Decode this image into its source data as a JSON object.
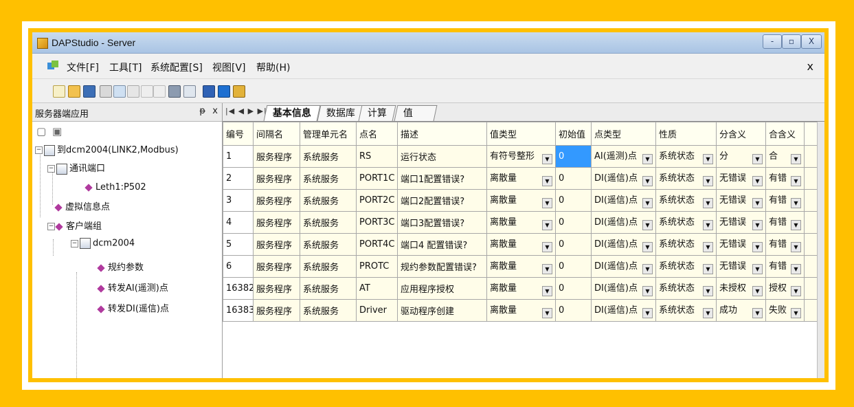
{
  "window": {
    "title": "DAPStudio - Server",
    "minimize_label": "-",
    "maximize_label": "▫",
    "close_label": "X"
  },
  "menu": {
    "items": [
      "文件[F]",
      "工具[T]",
      "系统配置[S]",
      "视图[V]",
      "帮助(H)"
    ],
    "close_label": "x"
  },
  "left_panel": {
    "title": "服务器端应用",
    "pin_label": "ᵽ",
    "close_label": "x",
    "tree": {
      "root": "到dcm2004(LINK2,Modbus)",
      "comm_port": "通讯端口",
      "eth": "Leth1:P502",
      "virtual": "虚拟信息点",
      "client_group": "客户端组",
      "dcm": "dcm2004",
      "protocol_params": "规约参数",
      "fwd_ai": "转发AI(遥测)点",
      "fwd_di": "转发DI(遥信)点"
    }
  },
  "tabs": [
    "基本信息",
    "数据库",
    "计算",
    "值"
  ],
  "grid": {
    "columns": [
      "编号",
      "间隔名",
      "管理单元名",
      "点名",
      "描述",
      "值类型",
      "初始值",
      "点类型",
      "性质",
      "分含义",
      "合含义"
    ],
    "rows": [
      [
        "1",
        "服务程序",
        "系统服务",
        "RS",
        "运行状态",
        "有符号整形",
        "0",
        "AI(遥测)点",
        "系统状态",
        "分",
        "合"
      ],
      [
        "2",
        "服务程序",
        "系统服务",
        "PORT1C",
        "端口1配置错误?",
        "离散量",
        "0",
        "DI(遥信)点",
        "系统状态",
        "无错误",
        "有错"
      ],
      [
        "3",
        "服务程序",
        "系统服务",
        "PORT2C",
        "端口2配置错误?",
        "离散量",
        "0",
        "DI(遥信)点",
        "系统状态",
        "无错误",
        "有错"
      ],
      [
        "4",
        "服务程序",
        "系统服务",
        "PORT3C",
        "端口3配置错误?",
        "离散量",
        "0",
        "DI(遥信)点",
        "系统状态",
        "无错误",
        "有错"
      ],
      [
        "5",
        "服务程序",
        "系统服务",
        "PORT4C",
        "端口4 配置错误?",
        "离散量",
        "0",
        "DI(遥信)点",
        "系统状态",
        "无错误",
        "有错"
      ],
      [
        "6",
        "服务程序",
        "系统服务",
        "PROTC",
        "规约参数配置错误?",
        "离散量",
        "0",
        "DI(遥信)点",
        "系统状态",
        "无错误",
        "有错"
      ],
      [
        "16382",
        "服务程序",
        "系统服务",
        "AT",
        "应用程序授权",
        "离散量",
        "0",
        "DI(遥信)点",
        "系统状态",
        "未授权",
        "授权"
      ],
      [
        "16383",
        "服务程序",
        "系统服务",
        "Driver",
        "驱动程序创建",
        "离散量",
        "0",
        "DI(遥信)点",
        "系统状态",
        "成功",
        "失败"
      ]
    ]
  }
}
